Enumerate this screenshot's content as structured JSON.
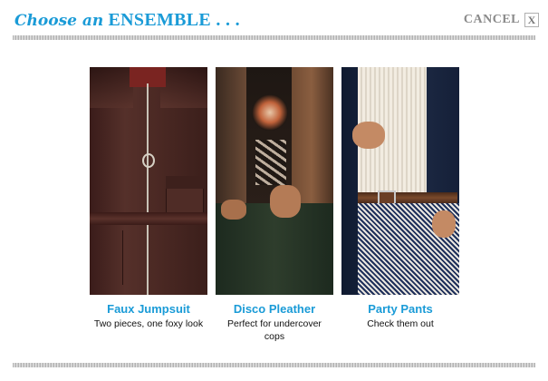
{
  "header": {
    "title_script": "Choose an",
    "title_caps": "ENSEMBLE",
    "title_ellipsis": " . . .",
    "cancel_label": "CANCEL",
    "cancel_x": "X"
  },
  "ensembles": [
    {
      "name": "Faux Jumpsuit",
      "description": "Two pieces, one foxy look"
    },
    {
      "name": "Disco Pleather",
      "description": "Perfect for undercover cops"
    },
    {
      "name": "Party Pants",
      "description": "Check them out"
    }
  ],
  "colors": {
    "accent": "#1a9bd7",
    "cancel": "#8a8a8a"
  }
}
